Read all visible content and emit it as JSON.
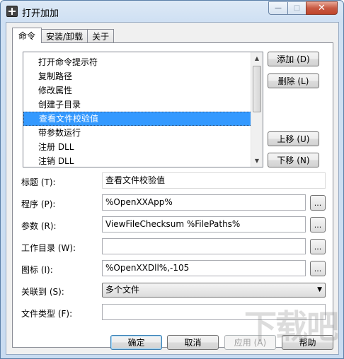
{
  "window": {
    "title": "打开加加"
  },
  "caption": {
    "minimize": "—",
    "maximize": "□",
    "close": "✕"
  },
  "tabs": [
    {
      "label": "命令",
      "active": true
    },
    {
      "label": "安装/卸载",
      "active": false
    },
    {
      "label": "关于",
      "active": false
    }
  ],
  "command_list": {
    "items": [
      {
        "label": "打开命令提示符",
        "selected": false
      },
      {
        "label": "复制路径",
        "selected": false
      },
      {
        "label": "修改属性",
        "selected": false
      },
      {
        "label": "创建子目录",
        "selected": false
      },
      {
        "label": "查看文件校验值",
        "selected": true
      },
      {
        "label": "带参数运行",
        "selected": false
      },
      {
        "label": "注册 DLL",
        "selected": false
      },
      {
        "label": "注销 DLL",
        "selected": false
      }
    ]
  },
  "list_buttons": {
    "add": "添加 (D)",
    "delete": "删除 (L)",
    "move_up": "上移 (U)",
    "move_down": "下移 (N)"
  },
  "form": {
    "title_label": "标题 (T):",
    "title_value": "查看文件校验值",
    "program_label": "程序 (P):",
    "program_value": "%OpenXXApp%",
    "params_label": "参数 (R):",
    "params_value": "ViewFileChecksum %FilePaths%",
    "workdir_label": "工作目录 (W):",
    "workdir_value": "",
    "icon_label": "图标 (I):",
    "icon_value": "%OpenXXDll%,-105",
    "assoc_label": "关联到 (S):",
    "assoc_value": "多个文件",
    "filetype_label": "文件类型 (F):",
    "filetype_value": "",
    "browse": "..."
  },
  "footer": {
    "ok": "确定",
    "cancel": "取消",
    "apply": "应用 (A)",
    "help": "帮助"
  },
  "watermark": {
    "text": "下载吧"
  }
}
